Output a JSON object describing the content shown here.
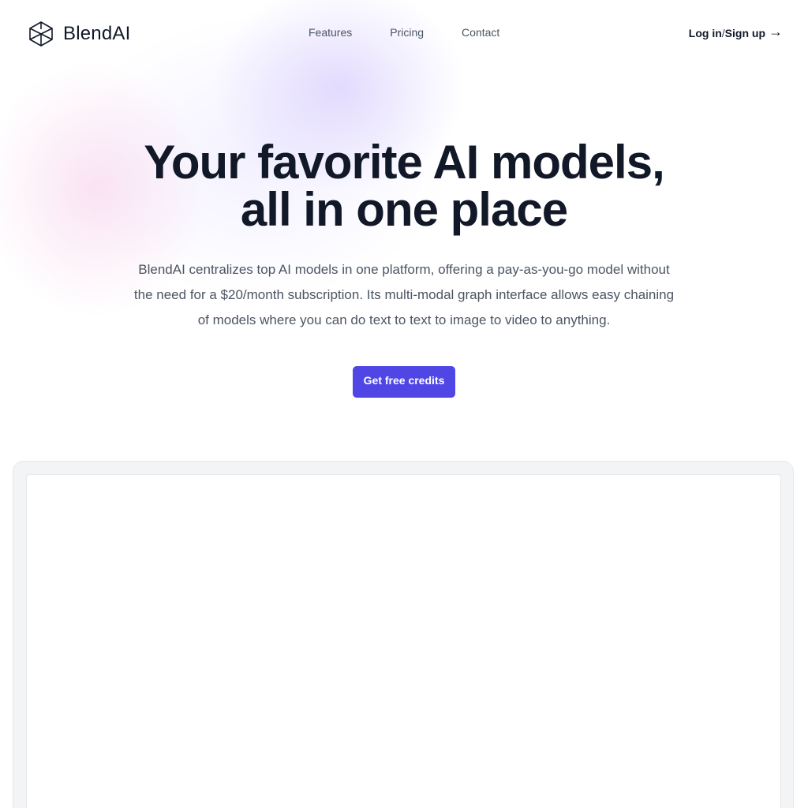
{
  "header": {
    "brand": "BlendAI",
    "logo_icon": "cube-icon",
    "nav": [
      {
        "label": "Features"
      },
      {
        "label": "Pricing"
      },
      {
        "label": "Contact"
      }
    ],
    "login_label": "Log in",
    "separator": "/",
    "signup_label": "Sign up",
    "arrow": "→"
  },
  "hero": {
    "title_line1": "Your favorite AI models,",
    "title_line2": "all in one place",
    "description": "BlendAI centralizes top AI models in one platform, offering a pay-as-you-go model without the need for a $20/month subscription. Its multi-modal graph interface allows easy chaining of models where you can do text to text to image to video to anything.",
    "cta_label": "Get free credits"
  },
  "colors": {
    "accent": "#4f46e5",
    "text_primary": "#111827",
    "text_secondary": "#4b5563"
  }
}
